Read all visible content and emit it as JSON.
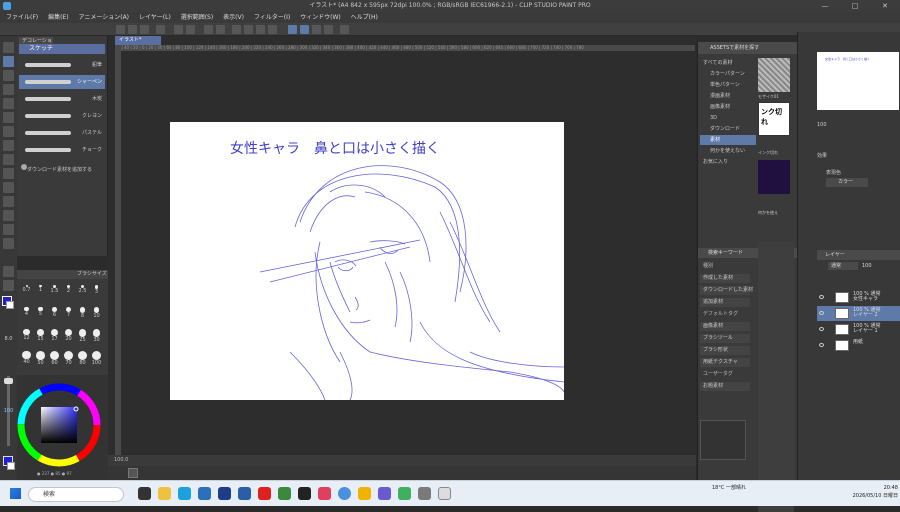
{
  "window": {
    "title": "イラスト* (A4 842 x 595px 72dpi 100.0% ; RGB/sRGB IEC61966-2.1) - CLIP STUDIO PAINT PRO",
    "buttons": {
      "minimize": "—",
      "maximize": "□",
      "close": "✕"
    }
  },
  "menu": [
    "ファイル(F)",
    "編集(E)",
    "アニメーション(A)",
    "レイヤー(L)",
    "選択範囲(S)",
    "表示(V)",
    "フィルター(I)",
    "ウィンドウ(W)",
    "ヘルプ(H)"
  ],
  "subtool": {
    "tab": "デコレーション",
    "header": "スケッチ",
    "brushes": [
      {
        "label": "鉛筆",
        "active": false
      },
      {
        "label": "シャーペン",
        "active": true
      },
      {
        "label": "木炭",
        "active": false
      },
      {
        "label": "クレヨン",
        "active": false
      },
      {
        "label": "パステル",
        "active": false
      },
      {
        "label": "チョーク",
        "active": false
      }
    ],
    "download": "ダウンロード素材を追加する"
  },
  "brush_size": {
    "tab": "ブラシサイズ",
    "sizes": [
      "0.7",
      "1",
      "1.5",
      "2",
      "2.5",
      "3",
      "4",
      "5",
      "6",
      "7",
      "8",
      "10",
      "12",
      "15",
      "17",
      "20",
      "25",
      "30",
      "40",
      "50",
      "60",
      "70",
      "80",
      "100"
    ]
  },
  "canvas": {
    "tab": "イラスト*",
    "caption": "女性キャラ　鼻と口は小さく描く",
    "ruler": "60 | 40 | 20 | 0 | 20 | 40 | 60 | 80 | 100 | 120 | 140 | 160 | 180 | 200 | 220 | 240 | 260 | 280 | 300 | 320 | 340 | 360 | 380 | 400 | 420 | 440 | 460 | 480 | 500 | 520 | 540 | 560 | 580 | 600 | 620 | 640 | 660 | 680 | 700 | 720 | 740 | 760 | 780",
    "zoom": "100.0"
  },
  "materials": {
    "header": "ASSETSで素材を探す",
    "tree": [
      {
        "label": "すべての素材",
        "active": false
      },
      {
        "label": "カラーパターン",
        "active": false
      },
      {
        "label": "単色パターン",
        "active": false
      },
      {
        "label": "漫画素材",
        "active": false
      },
      {
        "label": "画像素材",
        "active": false
      },
      {
        "label": "3D",
        "active": false
      },
      {
        "label": "ダウンロード",
        "active": false
      },
      {
        "label": "素材",
        "active": true
      },
      {
        "label": "何かを使えない",
        "active": false
      },
      {
        "label": "お気に入り",
        "active": false
      }
    ],
    "thumbs": [
      "モザイク01",
      "インク切れ",
      "何かを使え"
    ],
    "search_header": "検索キーワード",
    "keywords": [
      {
        "label": "種別",
        "type": "label"
      },
      {
        "label": "作成した素材",
        "type": "kw"
      },
      {
        "label": "ダウンロードした素材",
        "type": "kw"
      },
      {
        "label": "追加素材",
        "type": "kw"
      },
      {
        "label": "デフォルトタグ",
        "type": "label"
      },
      {
        "label": "画像素材",
        "type": "kw"
      },
      {
        "label": "ブラシツール",
        "type": "kw"
      },
      {
        "label": "ブラシ形状",
        "type": "kw"
      },
      {
        "label": "用紙テクスチャ",
        "type": "kw"
      },
      {
        "label": "ユーザータグ",
        "type": "label"
      },
      {
        "label": "お題素材",
        "type": "kw"
      }
    ]
  },
  "layers": {
    "header": "レイヤー",
    "blend": "通常",
    "opacity": "100",
    "effect_label": "効果",
    "expression_label": "表現色",
    "expression_value": "カラー",
    "rows": [
      {
        "label": "100 % 通常\n女性キャラ",
        "active": false
      },
      {
        "label": "100 % 通常\nレイヤー 2",
        "active": true
      },
      {
        "label": "100 % 通常\nレイヤー 1",
        "active": false
      },
      {
        "label": "用紙",
        "active": false
      }
    ]
  },
  "taskbar": {
    "search_placeholder": "検索",
    "weather": "18°C 一部晴れ",
    "time": "20:48",
    "date": "2026/05/10 日曜日"
  }
}
